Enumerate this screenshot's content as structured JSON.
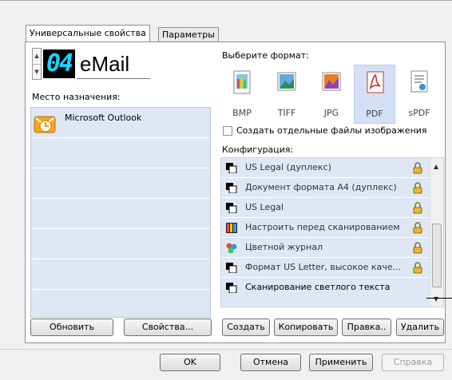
{
  "tabs": [
    {
      "label": "Универсальные свойства",
      "active": true
    },
    {
      "label": "Параметры",
      "active": false
    }
  ],
  "counter": {
    "value": "04",
    "destination_name": "eMail"
  },
  "destination": {
    "label": "Место назначения:",
    "items": [
      {
        "label": "Microsoft Outlook",
        "icon": "outlook-icon",
        "selected": true
      }
    ]
  },
  "format": {
    "label": "Выберите формат:",
    "items": [
      {
        "label": "BMP",
        "icon": "bmp-icon",
        "selected": false
      },
      {
        "label": "TIFF",
        "icon": "tiff-icon",
        "selected": false
      },
      {
        "label": "JPG",
        "icon": "jpg-icon",
        "selected": false
      },
      {
        "label": "PDF",
        "icon": "pdf-icon",
        "selected": true
      },
      {
        "label": "sPDF",
        "icon": "spdf-icon",
        "selected": false
      }
    ],
    "separate_files_label": "Создать отдельные файлы изображения",
    "separate_files_checked": false
  },
  "config": {
    "label": "Конфигурация:",
    "items": [
      {
        "label": "US Legal (дуплекс)",
        "icon": "scanner-icon",
        "locked": true
      },
      {
        "label": "Документ формата А4 (дуплекс)",
        "icon": "scanner-icon",
        "locked": true
      },
      {
        "label": "US Legal",
        "icon": "scanner-icon",
        "locked": true
      },
      {
        "label": "Настроить перед сканированием",
        "icon": "palette-icon",
        "locked": true
      },
      {
        "label": "Цветной журнал",
        "icon": "color-magazine-icon",
        "locked": true
      },
      {
        "label": "Формат US Letter, высокое каче...",
        "icon": "scanner-icon",
        "locked": true
      },
      {
        "label": "Сканирование светлого текста",
        "icon": "scanner-icon",
        "locked": false
      }
    ]
  },
  "buttons": {
    "refresh": "Обновить",
    "properties": "Свойства...",
    "create": "Создать",
    "copy": "Копировать",
    "edit": "Правка..",
    "delete": "Удалить",
    "ok": "OK",
    "cancel": "Отмена",
    "apply": "Применить",
    "help": "Справка"
  },
  "colors": {
    "lcd_digits": "#1ad5ff",
    "selection": "#dfe7f4",
    "pdf_selected": "#d3e0f5"
  }
}
